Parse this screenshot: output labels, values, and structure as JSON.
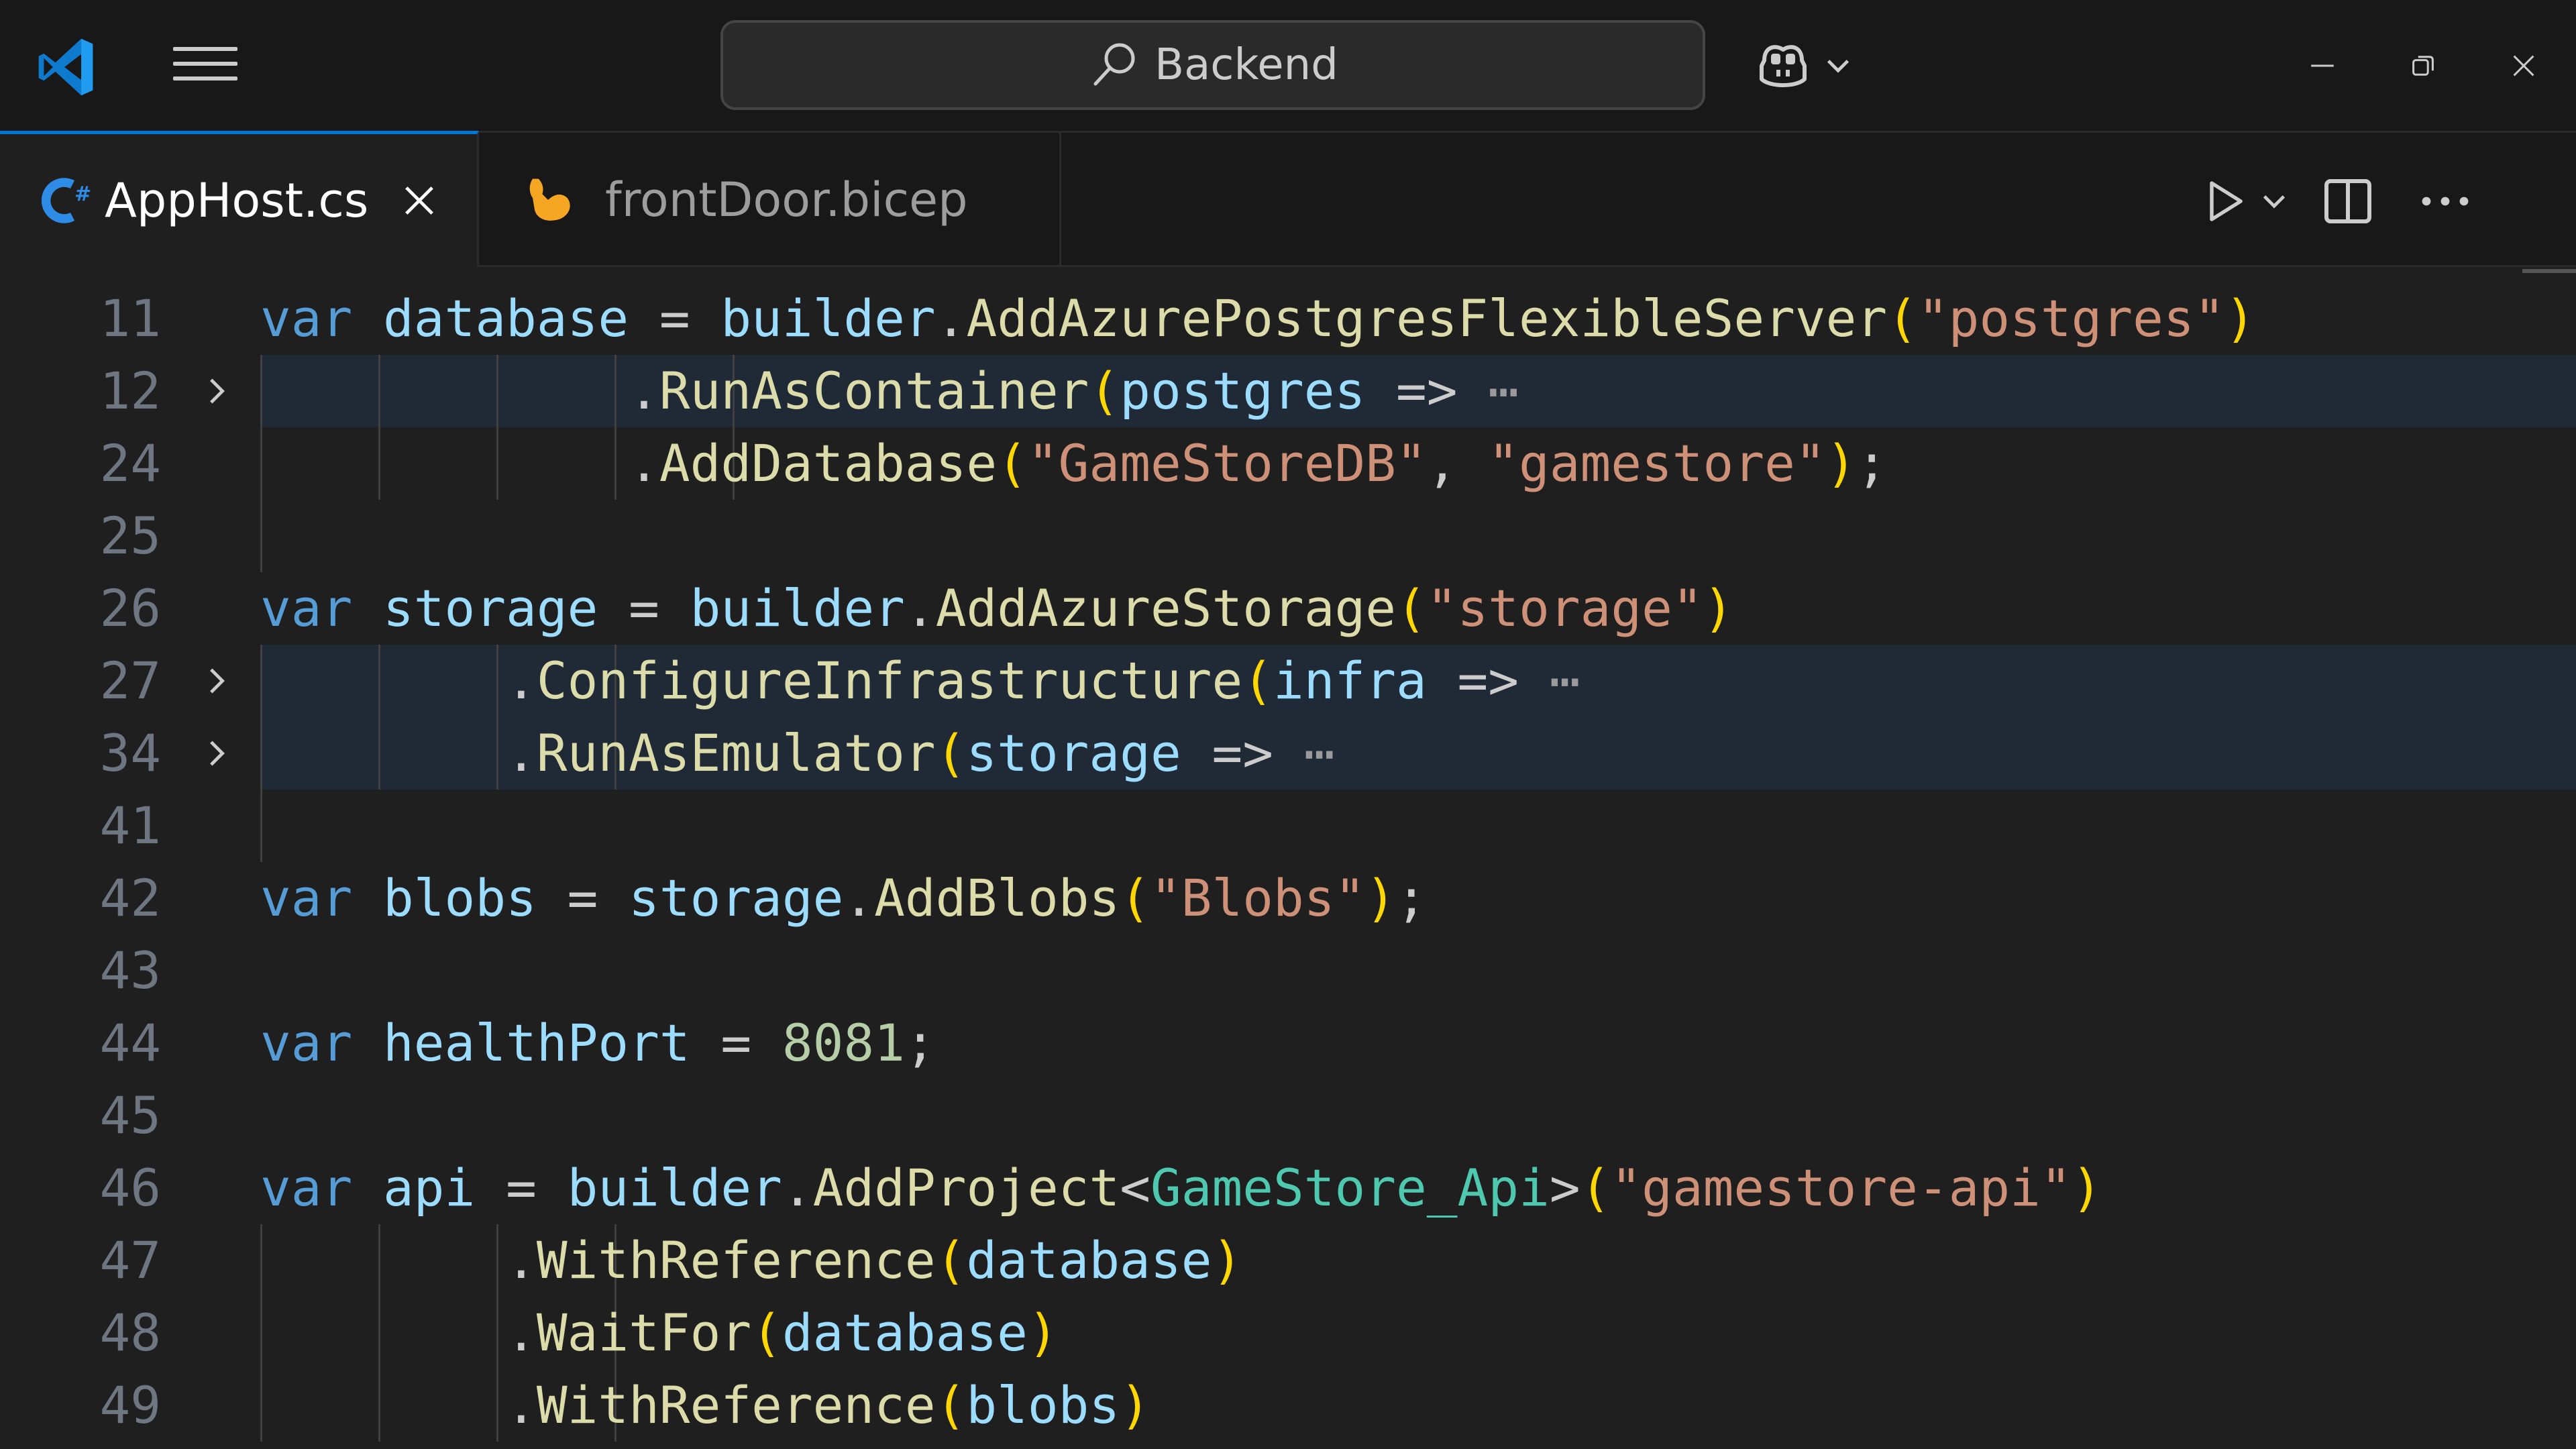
{
  "titlebar": {
    "search_label": "Backend",
    "icons": {
      "logo": "vscode-logo-icon",
      "menu": "hamburger-menu-icon",
      "search": "search-icon",
      "copilot": "copilot-icon",
      "minimize": "minimize-icon",
      "restore": "restore-icon",
      "close": "close-icon"
    }
  },
  "tabs": [
    {
      "label": "AppHost.cs",
      "icon": "csharp-file-icon",
      "active": true
    },
    {
      "label": "frontDoor.bicep",
      "icon": "bicep-file-icon",
      "active": false
    }
  ],
  "tab_actions": [
    "run-icon",
    "chevron-down-icon",
    "split-editor-icon",
    "more-actions-icon"
  ],
  "colors": {
    "accent": "#0078d4",
    "background": "#1f1f1f",
    "keyword": "#569cd6",
    "variable": "#9cdcfe",
    "function": "#dcdcaa",
    "string": "#ce9178",
    "number": "#b5cea8",
    "type": "#4ec9b0",
    "bracket": "#ffd700"
  },
  "editor": {
    "lines": [
      {
        "num": "11",
        "folded": false,
        "fold": false,
        "tokens": [
          [
            "kw",
            "var"
          ],
          [
            "pl",
            " "
          ],
          [
            "var",
            "database"
          ],
          [
            "pl",
            " = "
          ],
          [
            "var",
            "builder"
          ],
          [
            "pl",
            "."
          ],
          [
            "fn",
            "AddAzurePostgresFlexibleServer"
          ],
          [
            "br",
            "("
          ],
          [
            "str",
            "\"postgres\""
          ],
          [
            "br",
            ")"
          ]
        ]
      },
      {
        "num": "12",
        "folded": true,
        "fold": true,
        "tokens": [
          [
            "pl",
            "            ."
          ],
          [
            "fn",
            "RunAsContainer"
          ],
          [
            "br",
            "("
          ],
          [
            "var",
            "postgres"
          ],
          [
            "pl",
            " => "
          ],
          [
            "ell",
            "⋯"
          ]
        ]
      },
      {
        "num": "24",
        "folded": false,
        "fold": false,
        "tokens": [
          [
            "pl",
            "            ."
          ],
          [
            "fn",
            "AddDatabase"
          ],
          [
            "br",
            "("
          ],
          [
            "str",
            "\"GameStoreDB\""
          ],
          [
            "pl",
            ", "
          ],
          [
            "str",
            "\"gamestore\""
          ],
          [
            "br",
            ")"
          ],
          [
            "pl",
            ";"
          ]
        ]
      },
      {
        "num": "25",
        "folded": false,
        "fold": false,
        "tokens": []
      },
      {
        "num": "26",
        "folded": false,
        "fold": false,
        "tokens": [
          [
            "kw",
            "var"
          ],
          [
            "pl",
            " "
          ],
          [
            "var",
            "storage"
          ],
          [
            "pl",
            " = "
          ],
          [
            "var",
            "builder"
          ],
          [
            "pl",
            "."
          ],
          [
            "fn",
            "AddAzureStorage"
          ],
          [
            "br",
            "("
          ],
          [
            "str",
            "\"storage\""
          ],
          [
            "br",
            ")"
          ]
        ]
      },
      {
        "num": "27",
        "folded": true,
        "fold": true,
        "tokens": [
          [
            "pl",
            "        ."
          ],
          [
            "fn",
            "ConfigureInfrastructure"
          ],
          [
            "br",
            "("
          ],
          [
            "var",
            "infra"
          ],
          [
            "pl",
            " => "
          ],
          [
            "ell",
            "⋯"
          ]
        ]
      },
      {
        "num": "34",
        "folded": true,
        "fold": true,
        "tokens": [
          [
            "pl",
            "        ."
          ],
          [
            "fn",
            "RunAsEmulator"
          ],
          [
            "br",
            "("
          ],
          [
            "var",
            "storage"
          ],
          [
            "pl",
            " => "
          ],
          [
            "ell",
            "⋯"
          ]
        ]
      },
      {
        "num": "41",
        "folded": false,
        "fold": false,
        "tokens": []
      },
      {
        "num": "42",
        "folded": false,
        "fold": false,
        "tokens": [
          [
            "kw",
            "var"
          ],
          [
            "pl",
            " "
          ],
          [
            "var",
            "blobs"
          ],
          [
            "pl",
            " = "
          ],
          [
            "var",
            "storage"
          ],
          [
            "pl",
            "."
          ],
          [
            "fn",
            "AddBlobs"
          ],
          [
            "br",
            "("
          ],
          [
            "str",
            "\"Blobs\""
          ],
          [
            "br",
            ")"
          ],
          [
            "pl",
            ";"
          ]
        ]
      },
      {
        "num": "43",
        "folded": false,
        "fold": false,
        "tokens": []
      },
      {
        "num": "44",
        "folded": false,
        "fold": false,
        "tokens": [
          [
            "kw",
            "var"
          ],
          [
            "pl",
            " "
          ],
          [
            "var",
            "healthPort"
          ],
          [
            "pl",
            " = "
          ],
          [
            "num",
            "8081"
          ],
          [
            "pl",
            ";"
          ]
        ]
      },
      {
        "num": "45",
        "folded": false,
        "fold": false,
        "tokens": []
      },
      {
        "num": "46",
        "folded": false,
        "fold": false,
        "tokens": [
          [
            "kw",
            "var"
          ],
          [
            "pl",
            " "
          ],
          [
            "var",
            "api"
          ],
          [
            "pl",
            " = "
          ],
          [
            "var",
            "builder"
          ],
          [
            "pl",
            "."
          ],
          [
            "fn",
            "AddProject"
          ],
          [
            "pl",
            "<"
          ],
          [
            "type",
            "GameStore_Api"
          ],
          [
            "pl",
            ">"
          ],
          [
            "br",
            "("
          ],
          [
            "str",
            "\"gamestore-api\""
          ],
          [
            "br",
            ")"
          ]
        ]
      },
      {
        "num": "47",
        "folded": false,
        "fold": false,
        "tokens": [
          [
            "pl",
            "        ."
          ],
          [
            "fn",
            "WithReference"
          ],
          [
            "br",
            "("
          ],
          [
            "var",
            "database"
          ],
          [
            "br",
            ")"
          ]
        ]
      },
      {
        "num": "48",
        "folded": false,
        "fold": false,
        "tokens": [
          [
            "pl",
            "        ."
          ],
          [
            "fn",
            "WaitFor"
          ],
          [
            "br",
            "("
          ],
          [
            "var",
            "database"
          ],
          [
            "br",
            ")"
          ]
        ]
      },
      {
        "num": "49",
        "folded": false,
        "fold": false,
        "tokens": [
          [
            "pl",
            "        ."
          ],
          [
            "fn",
            "WithReference"
          ],
          [
            "br",
            "("
          ],
          [
            "var",
            "blobs"
          ],
          [
            "br",
            ")"
          ]
        ]
      }
    ]
  }
}
